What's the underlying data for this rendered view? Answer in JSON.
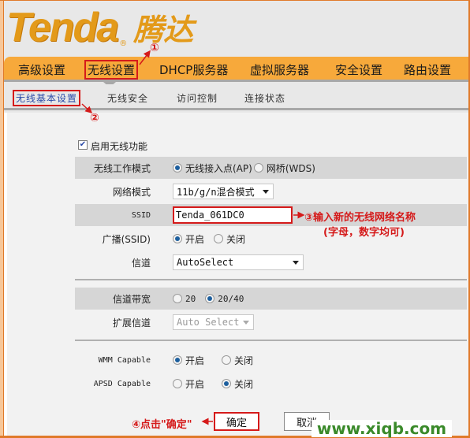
{
  "brand": {
    "logo_text": "Tenda",
    "registered_mark": "®",
    "logo_cn": "腾达"
  },
  "main_nav": {
    "items": [
      {
        "label": "高级设置",
        "active": false
      },
      {
        "label": "无线设置",
        "active": true
      },
      {
        "label": "DHCP服务器",
        "active": false
      },
      {
        "label": "虚拟服务器",
        "active": false
      },
      {
        "label": "安全设置",
        "active": false
      },
      {
        "label": "路由设置",
        "active": false
      }
    ]
  },
  "sub_nav": {
    "items": [
      {
        "label": "无线基本设置",
        "active": true
      },
      {
        "label": "无线安全",
        "active": false
      },
      {
        "label": "访问控制",
        "active": false
      },
      {
        "label": "连接状态",
        "active": false
      }
    ]
  },
  "form": {
    "enable_wireless": {
      "label": "启用无线功能",
      "checked": true,
      "check_glyph": "✔"
    },
    "work_mode": {
      "label": "无线工作模式",
      "options": [
        "无线接入点(AP)",
        "网桥(WDS)"
      ],
      "selected": "无线接入点(AP)"
    },
    "network_mode": {
      "label": "网络模式",
      "value": "11b/g/n混合模式"
    },
    "ssid": {
      "label": "SSID",
      "value": "Tenda_061DC0"
    },
    "broadcast": {
      "label": "广播(SSID)",
      "options": [
        "开启",
        "关闭"
      ],
      "selected": "开启"
    },
    "channel": {
      "label": "信道",
      "value": "AutoSelect"
    },
    "bandwidth": {
      "label": "信道带宽",
      "options": [
        "20",
        "20/40"
      ],
      "selected": "20/40"
    },
    "ext_channel": {
      "label": "扩展信道",
      "value": "Auto Select",
      "disabled": true
    },
    "wmm": {
      "label": "WMM Capable",
      "options": [
        "开启",
        "关闭"
      ],
      "selected": "开启"
    },
    "apsd": {
      "label": "APSD Capable",
      "options": [
        "开启",
        "关闭"
      ],
      "selected": "关闭"
    }
  },
  "buttons": {
    "ok": "确定",
    "cancel": "取消"
  },
  "annotations": {
    "step1": "①",
    "step2": "②",
    "step3_line1": "③输入新的无线网络名称",
    "step3_line2": "(字母，数字均可)",
    "step4": "④点击\"确定\""
  },
  "annotation_color": "#d51a1a",
  "accent_color": "#f7a93b",
  "watermark": "www.xiqb.com"
}
